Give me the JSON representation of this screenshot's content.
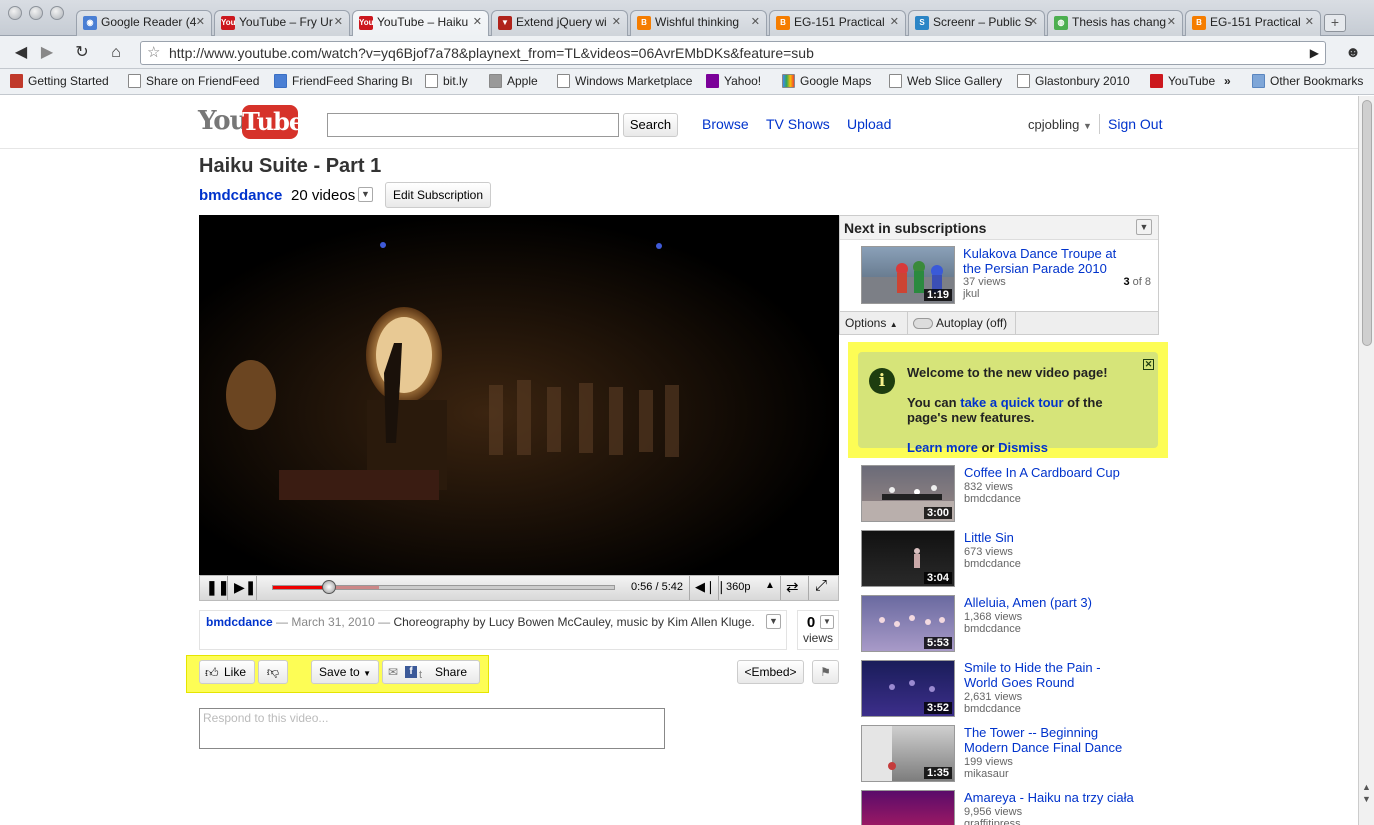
{
  "browser": {
    "tabs": [
      {
        "label": "Google Reader (4",
        "icon": "rss-icon",
        "color": "#4a7fd4"
      },
      {
        "label": "YouTube – Fry Ur",
        "icon": "youtube-icon",
        "color": "#cc181e"
      },
      {
        "label": "YouTube – Haiku",
        "icon": "youtube-icon",
        "color": "#cc181e"
      },
      {
        "label": "Extend jQuery wi",
        "icon": "ref-icon",
        "color": "#b0231b"
      },
      {
        "label": "Wishful thinking",
        "icon": "blogger-icon",
        "color": "#f57d00"
      },
      {
        "label": "EG-151 Practical",
        "icon": "blogger-icon",
        "color": "#f57d00"
      },
      {
        "label": "Screenr – Public S",
        "icon": "screenr-icon",
        "color": "#2b85c6"
      },
      {
        "label": "Thesis has chang",
        "icon": "globe-icon",
        "color": "#4caf50"
      },
      {
        "label": "EG-151 Practical",
        "icon": "blogger-icon",
        "color": "#f57d00"
      }
    ],
    "new_tab": "+",
    "url": "http://www.youtube.com/watch?v=yq6Bjof7a78&playnext_from=TL&videos=06AvrEMbDKs&feature=sub",
    "bookmarks": [
      "Getting Started",
      "Share on FriendFeed",
      "FriendFeed Sharing Bı",
      "bit.ly",
      "Apple",
      "Windows Marketplace",
      "Yahoo!",
      "Google Maps",
      "Web Slice Gallery",
      "Glastonbury 2010",
      "YouTube"
    ],
    "more_bookmarks": "»",
    "other_bookmarks": "Other Bookmarks"
  },
  "header": {
    "logo_you": "You",
    "logo_tube": "Tube",
    "search_button": "Search",
    "nav": [
      "Browse",
      "TV Shows",
      "Upload"
    ],
    "user": "cpjobling",
    "sign_out": "Sign Out"
  },
  "video": {
    "title": "Haiku Suite - Part 1",
    "channel": "bmdcdance",
    "video_count": "20 videos",
    "edit_subscription": "Edit Subscription",
    "time": "0:56 / 5:42",
    "quality": "360p",
    "progress_played": 0.164,
    "progress_loaded": 0.31,
    "desc_channel": "bmdcdance",
    "desc_date": "— March 31, 2010 —",
    "desc_text": "Choreography by Lucy Bowen McCauley, music by Kim Allen Kluge.",
    "views_count": "0",
    "views_label": "views",
    "like": "Like",
    "save_to": "Save to",
    "share": "Share",
    "embed": "<Embed>",
    "respond_placeholder": "Respond to this video..."
  },
  "sidebar": {
    "next_title": "Next in subscriptions",
    "next_video": {
      "title": "Kulakova Dance Troupe at the Persian Parade 2010",
      "views": "37 views",
      "user": "jkul",
      "duration": "1:19",
      "position": "3",
      "of_total": "of 8"
    },
    "options": "Options",
    "autoplay": "Autoplay (off)",
    "welcome": {
      "heading": "Welcome to the new video page!",
      "text_1": "You can",
      "tour_link": "take a quick tour",
      "text_2": "of the page's new features.",
      "learn_more": "Learn more",
      "or": "or",
      "dismiss": "Dismiss"
    },
    "related": [
      {
        "title": "Coffee In A Cardboard Cup",
        "views": "832 views",
        "user": "bmdcdance",
        "duration": "3:00"
      },
      {
        "title": "Little Sin",
        "views": "673 views",
        "user": "bmdcdance",
        "duration": "3:04"
      },
      {
        "title": "Alleluia, Amen (part 3)",
        "views": "1,368 views",
        "user": "bmdcdance",
        "duration": "5:53"
      },
      {
        "title": "Smile to Hide the Pain - World Goes Round",
        "views": "2,631 views",
        "user": "bmdcdance",
        "duration": "3:52"
      },
      {
        "title": "The Tower -- Beginning Modern Dance Final Dance",
        "views": "199 views",
        "user": "mikasaur",
        "duration": "1:35"
      },
      {
        "title": "Amareya - Haiku na trzy ciała",
        "views": "9,956 views",
        "user": "graffitipress",
        "duration": ""
      }
    ]
  }
}
